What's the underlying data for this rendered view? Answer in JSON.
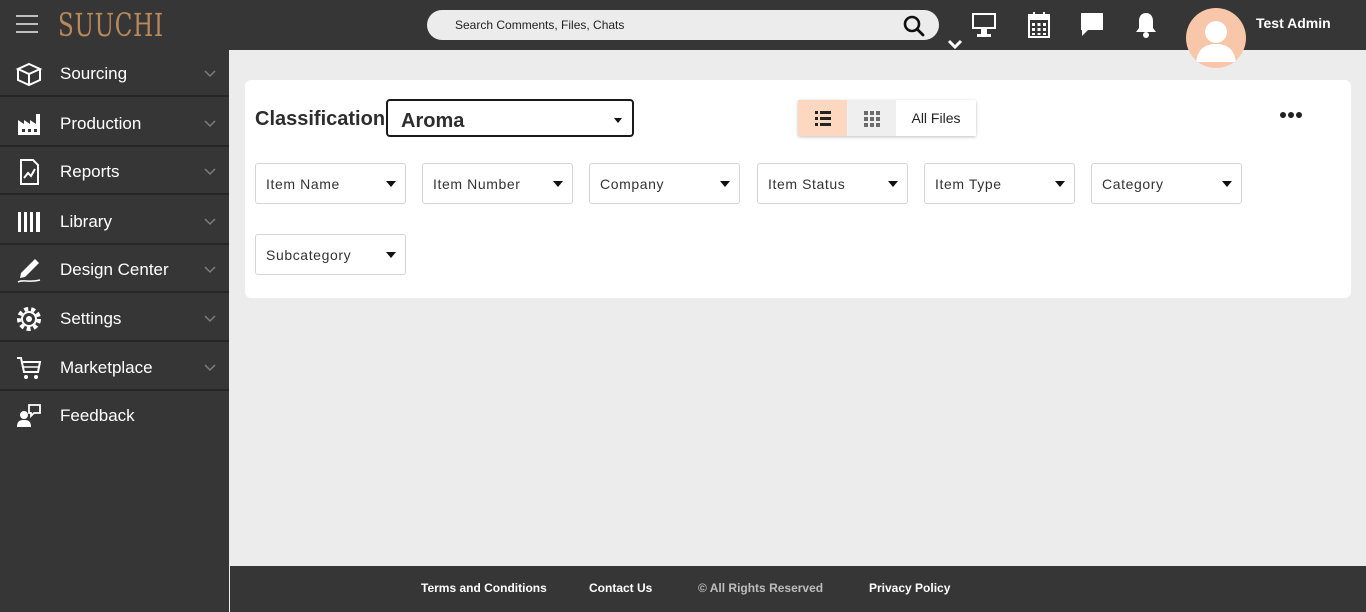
{
  "header": {
    "logo": "SUUCHI",
    "search_placeholder": "Search Comments, Files, Chats",
    "user_name": "Test Admin",
    "icons": [
      "menu-icon",
      "search-icon",
      "monitor-icon",
      "calendar-icon",
      "chat-icon",
      "bell-icon",
      "avatar"
    ]
  },
  "sidebar": {
    "items": [
      {
        "label": "Sourcing",
        "icon": "box-icon"
      },
      {
        "label": "Production",
        "icon": "factory-icon"
      },
      {
        "label": "Reports",
        "icon": "report-icon"
      },
      {
        "label": "Library",
        "icon": "library-icon"
      },
      {
        "label": "Design Center",
        "icon": "pen-icon"
      },
      {
        "label": "Settings",
        "icon": "gear-icon"
      },
      {
        "label": "Marketplace",
        "icon": "cart-icon"
      },
      {
        "label": "Feedback",
        "icon": "feedback-icon"
      }
    ]
  },
  "main": {
    "classification_label": "Classification",
    "classification_value": "Aroma",
    "all_files_label": "All Files",
    "filters": [
      "Item Name",
      "Item Number",
      "Company",
      "Item Status",
      "Item Type",
      "Category",
      "Subcategory"
    ]
  },
  "footer": {
    "terms": "Terms and Conditions",
    "contact": "Contact Us",
    "rights": "© All Rights Reserved",
    "privacy": "Privacy Policy"
  },
  "colors": {
    "bar": "#363636",
    "accent": "#b8895a",
    "highlight": "#fdd7c0",
    "background": "#ececec"
  }
}
